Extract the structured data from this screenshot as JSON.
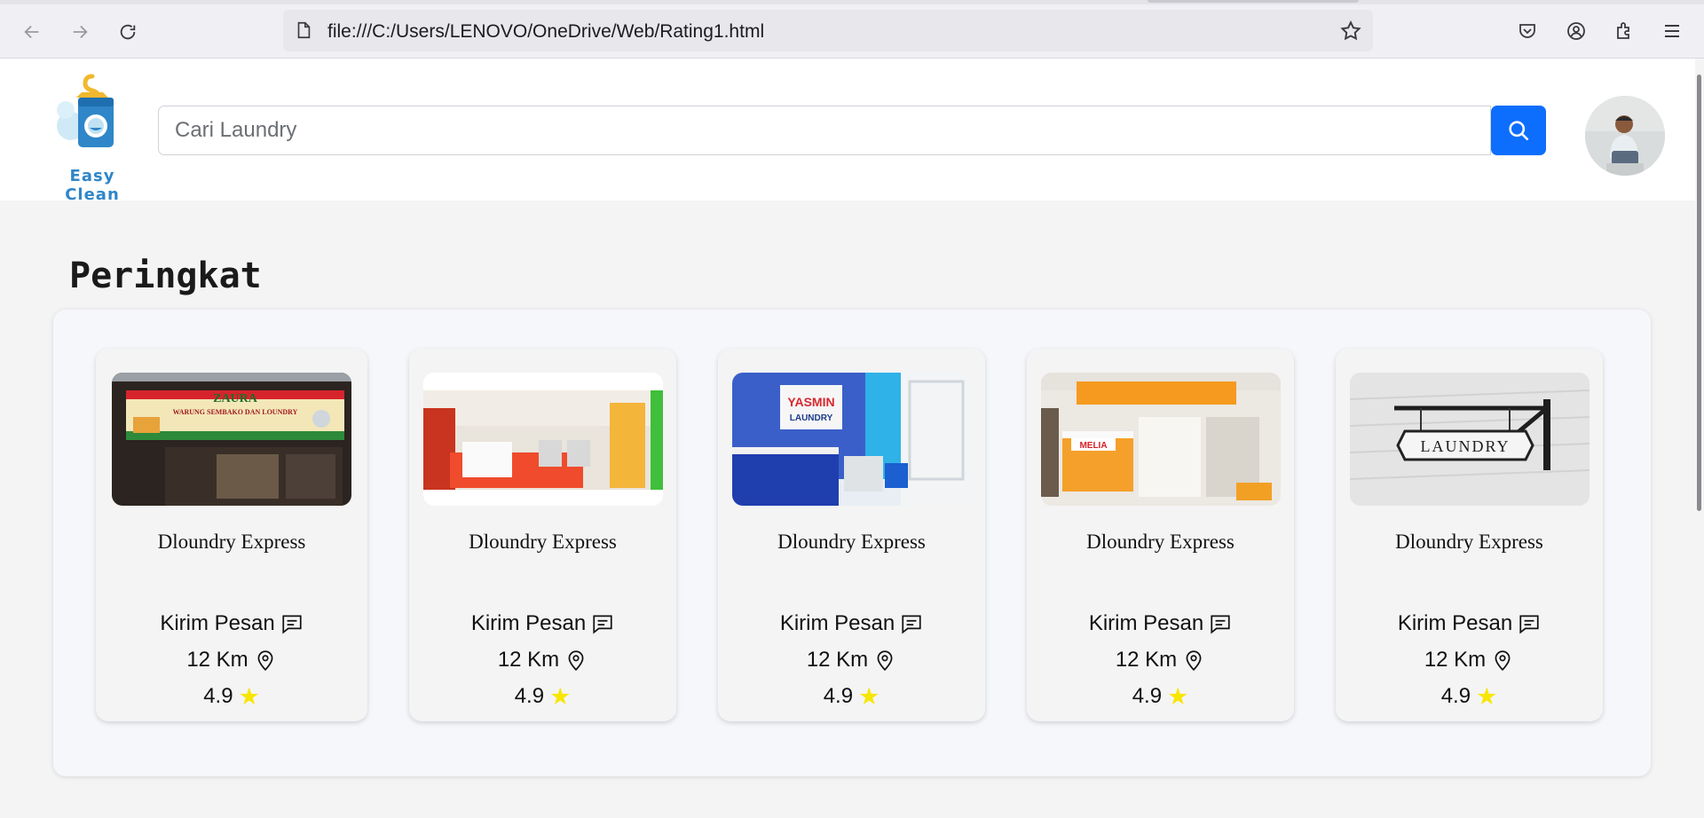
{
  "browser": {
    "url": "file:///C:/Users/LENOVO/OneDrive/Web/Rating1.html",
    "icons": [
      "back-icon",
      "forward-icon",
      "reload-icon",
      "page-icon",
      "bookmark-star-icon",
      "pocket-icon",
      "account-icon",
      "extensions-icon",
      "menu-icon"
    ]
  },
  "header": {
    "logo_text": "Easy Clean",
    "search_placeholder": "Cari Laundry",
    "search_icon": "search-icon",
    "accent_color": "#0d6efd"
  },
  "main": {
    "title": "Peringkat",
    "cards": [
      {
        "name": "Dloundry Express",
        "message_label": "Kirim Pesan",
        "distance": "12 Km",
        "rating": "4.9"
      },
      {
        "name": "Dloundry Express",
        "message_label": "Kirim Pesan",
        "distance": "12 Km",
        "rating": "4.9"
      },
      {
        "name": "Dloundry Express",
        "message_label": "Kirim Pesan",
        "distance": "12 Km",
        "rating": "4.9"
      },
      {
        "name": "Dloundry Express",
        "message_label": "Kirim Pesan",
        "distance": "12 Km",
        "rating": "4.9"
      },
      {
        "name": "Dloundry Express",
        "message_label": "Kirim Pesan",
        "distance": "12 Km",
        "rating": "4.9"
      }
    ],
    "image_signs": [
      "ZAURA",
      "WARUNG SEMBAKO DAN LOUNDRY",
      "YASMIN",
      "LAUNDRY",
      "MELIA",
      "LAUNDRY"
    ],
    "star_color": "#f7e600"
  }
}
